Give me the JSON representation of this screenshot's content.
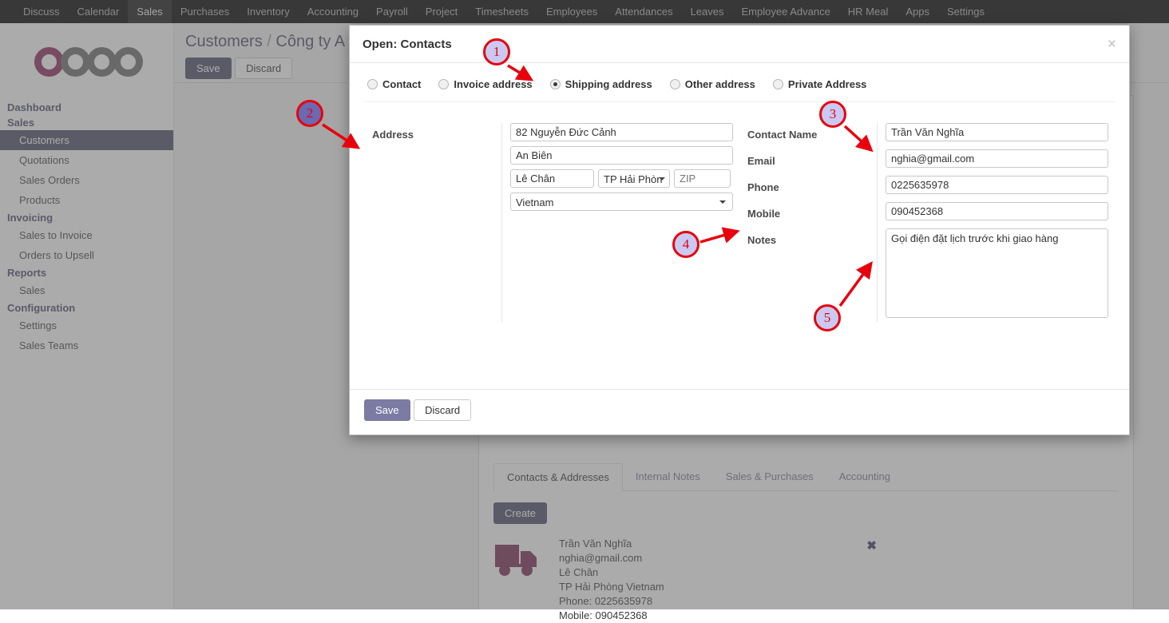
{
  "navbar": {
    "items": [
      {
        "label": "Discuss",
        "active": false
      },
      {
        "label": "Calendar",
        "active": false
      },
      {
        "label": "Sales",
        "active": true
      },
      {
        "label": "Purchases",
        "active": false
      },
      {
        "label": "Inventory",
        "active": false
      },
      {
        "label": "Accounting",
        "active": false
      },
      {
        "label": "Payroll",
        "active": false
      },
      {
        "label": "Project",
        "active": false
      },
      {
        "label": "Timesheets",
        "active": false
      },
      {
        "label": "Employees",
        "active": false
      },
      {
        "label": "Attendances",
        "active": false
      },
      {
        "label": "Leaves",
        "active": false
      },
      {
        "label": "Employee Advance",
        "active": false
      },
      {
        "label": "HR Meal",
        "active": false
      },
      {
        "label": "Apps",
        "active": false
      },
      {
        "label": "Settings",
        "active": false
      }
    ]
  },
  "sidebar": {
    "logo": "odoo",
    "groups": [
      {
        "title": "Dashboard",
        "items": []
      },
      {
        "title": "Sales",
        "items": [
          {
            "label": "Customers",
            "active": true
          },
          {
            "label": "Quotations",
            "active": false
          },
          {
            "label": "Sales Orders",
            "active": false
          },
          {
            "label": "Products",
            "active": false
          }
        ]
      },
      {
        "title": "Invoicing",
        "items": [
          {
            "label": "Sales to Invoice",
            "active": false
          },
          {
            "label": "Orders to Upsell",
            "active": false
          }
        ]
      },
      {
        "title": "Reports",
        "items": [
          {
            "label": "Sales",
            "active": false
          }
        ]
      },
      {
        "title": "Configuration",
        "items": [
          {
            "label": "Settings",
            "active": false
          },
          {
            "label": "Sales Teams",
            "active": false
          }
        ]
      }
    ]
  },
  "breadcrumb": {
    "root": "Customers",
    "separator": "/",
    "current": "Công ty A"
  },
  "control_bar": {
    "save_label": "Save",
    "discard_label": "Discard"
  },
  "notebook": {
    "tabs": [
      {
        "label": "Contacts & Addresses",
        "active": true
      },
      {
        "label": "Internal Notes",
        "active": false
      },
      {
        "label": "Sales & Purchases",
        "active": false
      },
      {
        "label": "Accounting",
        "active": false
      }
    ],
    "create_label": "Create",
    "contact_card": {
      "icon": "delivery-truck-icon",
      "name": "Trần Văn Nghĩa",
      "email": "nghia@gmail.com",
      "street2": "Lê Chân",
      "city_country": "TP Hải Phòng Vietnam",
      "phone": "Phone: 0225635978",
      "mobile": "Mobile: 090452368",
      "remove_icon": "✖"
    }
  },
  "modal": {
    "title": "Open: Contacts",
    "close_icon": "×",
    "address_types": [
      {
        "label": "Contact",
        "checked": false
      },
      {
        "label": "Invoice address",
        "checked": false
      },
      {
        "label": "Shipping address",
        "checked": true
      },
      {
        "label": "Other address",
        "checked": false
      },
      {
        "label": "Private Address",
        "checked": false
      }
    ],
    "left": {
      "address_label": "Address",
      "street": "82 Nguyễn Đức Cảnh",
      "street2": "An Biên",
      "city": "Lê Chân",
      "state": "TP Hải Phòn",
      "zip": "",
      "zip_placeholder": "ZIP",
      "country": "Vietnam"
    },
    "right": {
      "contact_name_label": "Contact Name",
      "contact_name": "Trần Văn Nghĩa",
      "email_label": "Email",
      "email": "nghia@gmail.com",
      "phone_label": "Phone",
      "phone": "0225635978",
      "mobile_label": "Mobile",
      "mobile": "090452368",
      "notes_label": "Notes",
      "notes": "Gọi điện đặt lịch trước khi giao hàng"
    },
    "footer": {
      "save_label": "Save",
      "discard_label": "Discard"
    }
  },
  "annotations": [
    {
      "number": "1",
      "style": "light"
    },
    {
      "number": "2",
      "style": "dark"
    },
    {
      "number": "3",
      "style": "light"
    },
    {
      "number": "4",
      "style": "light"
    },
    {
      "number": "5",
      "style": "light"
    }
  ],
  "colors": {
    "brand_purple": "#8f2b5e",
    "odoo_indigo": "#4f4f6b",
    "annotation_red": "#e8000d",
    "navbar_black": "#000000"
  }
}
